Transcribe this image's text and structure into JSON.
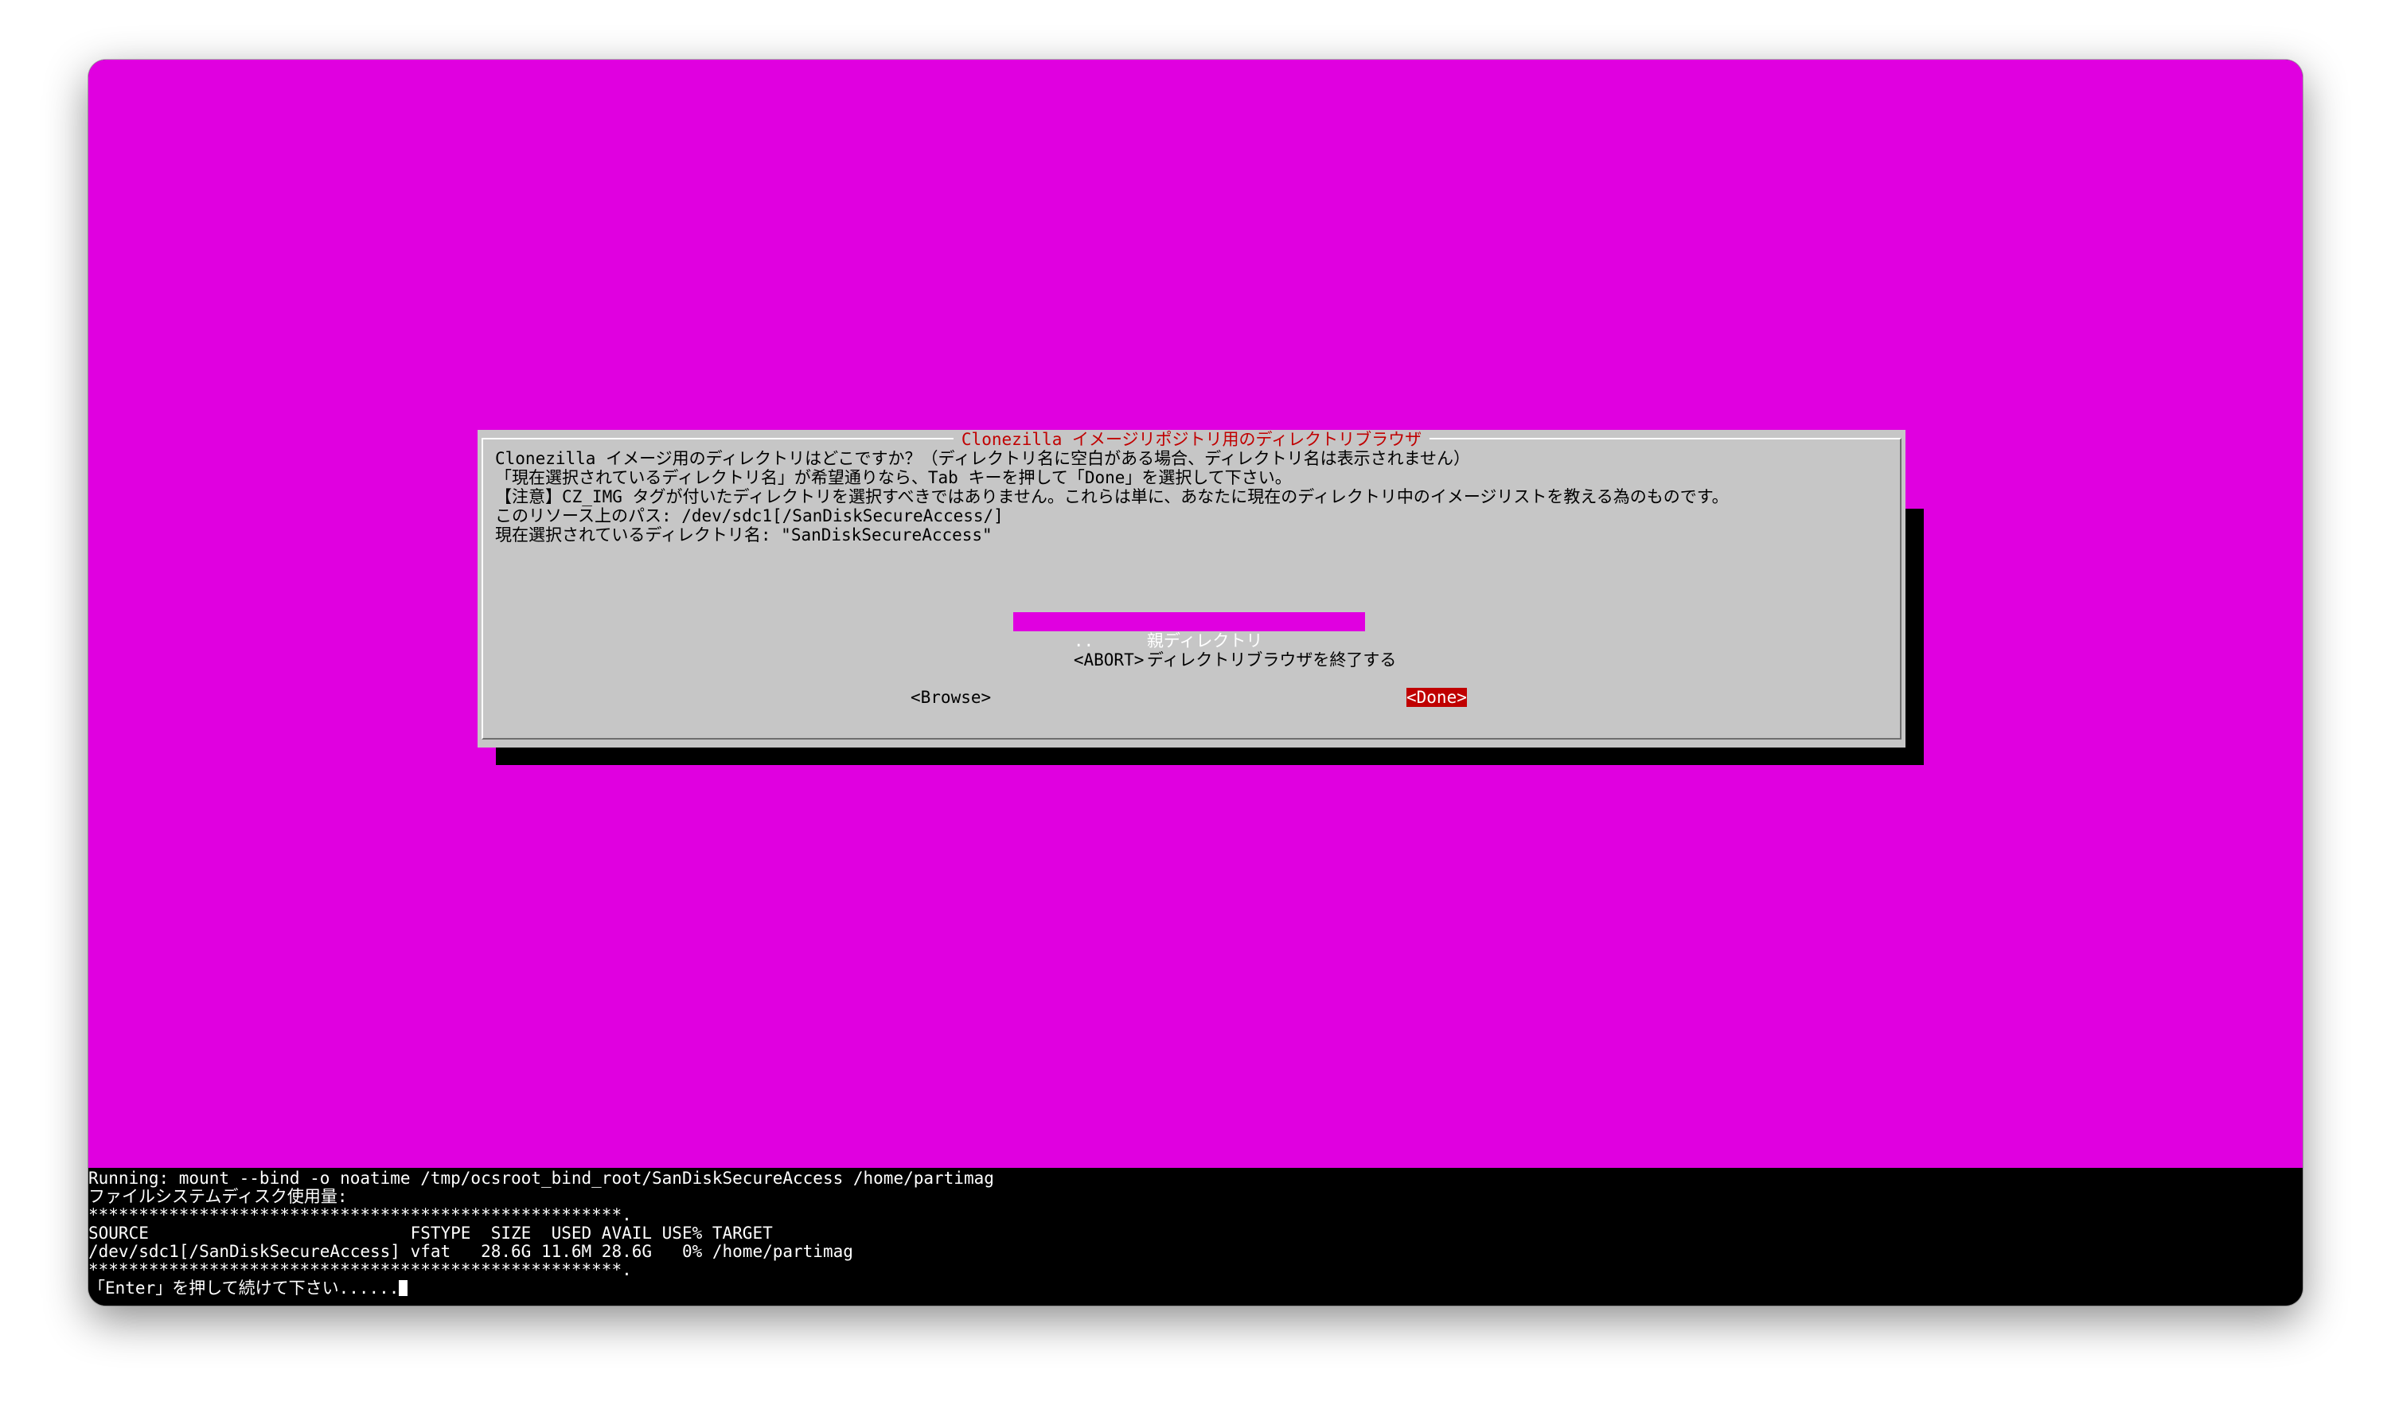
{
  "dialog": {
    "title": "Clonezilla イメージリポジトリ用のディレクトリブラウザ",
    "lines": [
      "Clonezilla イメージ用のディレクトリはどこですか？（ディレクトリ名に空白がある場合、ディレクトリ名は表示されません）",
      "「現在選択されているディレクトリ名」が希望通りなら、Tab キーを押して「Done」を選択して下さい。",
      "【注意】CZ_IMG タグが付いたディレクトリを選択すべきではありません。これらは単に、あなたに現在のディレクトリ中のイメージリストを教える為のものです。",
      "このリソース上のパス: /dev/sdc1[/SanDiskSecureAccess/]",
      "現在選択されているディレクトリ名: \"SanDiskSecureAccess\""
    ],
    "menu": [
      {
        "tag": "..",
        "label": "親ディレクトリ"
      },
      {
        "tag": "<ABORT>",
        "label": "ディレクトリブラウザを終了する"
      }
    ],
    "browse_label": "<Browse>",
    "done_label": "<Done>"
  },
  "terminal": {
    "lines": [
      "Running: mount --bind -o noatime /tmp/ocsroot_bind_root/SanDiskSecureAccess /home/partimag",
      "ファイルシステムディスク使用量:",
      "*****************************************************.",
      "SOURCE                          FSTYPE  SIZE  USED AVAIL USE% TARGET",
      "/dev/sdc1[/SanDiskSecureAccess] vfat   28.6G 11.6M 28.6G   0% /home/partimag",
      "*****************************************************.",
      "「Enter」を押して続けて下さい......"
    ]
  },
  "colors": {
    "background": "#e000e0",
    "dialog": "#c6c6c6",
    "title": "#c00000",
    "selected": "#e000e0",
    "done_button": "#c00000"
  }
}
